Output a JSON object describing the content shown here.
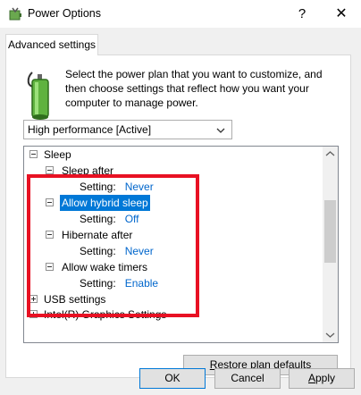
{
  "window": {
    "title": "Power Options",
    "help_glyph": "?",
    "close_glyph": "✕"
  },
  "tab": {
    "label": "Advanced settings"
  },
  "description": "Select the power plan that you want to customize, and then choose settings that reflect how you want your computer to manage power.",
  "plan_select": {
    "value": "High performance [Active]"
  },
  "tree": {
    "sleep_label": "Sleep",
    "sleep_after_label": "Sleep after",
    "sleep_after_setting_label": "Setting:",
    "sleep_after_value": "Never",
    "hybrid_label": "Allow hybrid sleep",
    "hybrid_setting_label": "Setting:",
    "hybrid_value": "Off",
    "hibernate_label": "Hibernate after",
    "hibernate_setting_label": "Setting:",
    "hibernate_value": "Never",
    "wake_label": "Allow wake timers",
    "wake_setting_label": "Setting:",
    "wake_value": "Enable",
    "usb_label": "USB settings",
    "intel_label": "Intel(R) Graphics Settings"
  },
  "buttons": {
    "restore_first": "R",
    "restore_rest": "estore plan defaults",
    "ok": "OK",
    "cancel": "Cancel",
    "apply_first": "A",
    "apply_rest": "pply"
  },
  "colors": {
    "highlight": "#0078d7",
    "setting_value": "#0066cc",
    "annotation_box": "#e81123"
  },
  "icons": [
    "power-options-icon",
    "help-icon",
    "close-icon",
    "battery-plug-icon",
    "chevron-down-icon",
    "expand-icon",
    "collapse-icon",
    "scroll-up-icon",
    "scroll-down-icon"
  ]
}
